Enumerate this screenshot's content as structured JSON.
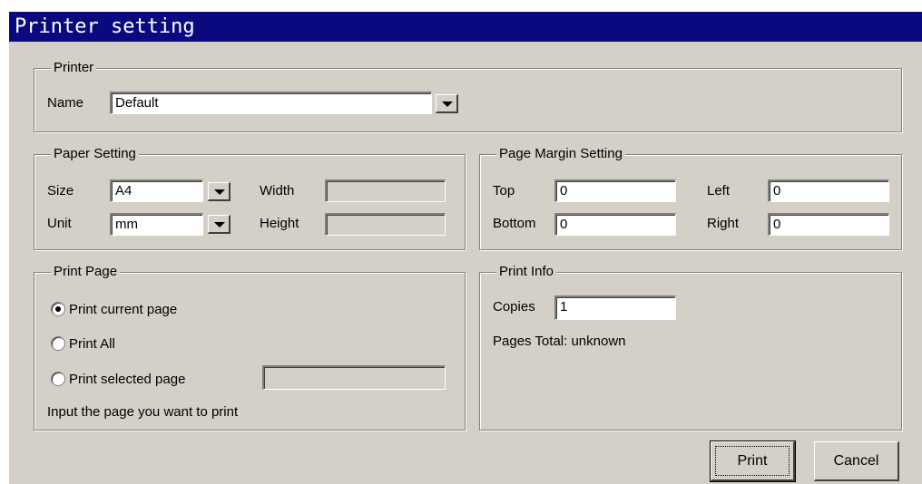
{
  "window": {
    "title": "Printer setting"
  },
  "printer": {
    "legend": "Printer",
    "name_label": "Name",
    "name_value": "Default"
  },
  "paper": {
    "legend": "Paper Setting",
    "size_label": "Size",
    "size_value": "A4",
    "width_label": "Width",
    "width_value": "",
    "unit_label": "Unit",
    "unit_value": "mm",
    "height_label": "Height",
    "height_value": ""
  },
  "margin": {
    "legend": "Page Margin Setting",
    "top_label": "Top",
    "top_value": "0",
    "left_label": "Left",
    "left_value": "0",
    "bottom_label": "Bottom",
    "bottom_value": "0",
    "right_label": "Right",
    "right_value": "0"
  },
  "print_page": {
    "legend": "Print Page",
    "options": [
      {
        "label": "Print current page",
        "checked": true
      },
      {
        "label": "Print All",
        "checked": false
      },
      {
        "label": "Print selected page",
        "checked": false
      }
    ],
    "selected_pages_value": "",
    "hint": "Input the page you want to print"
  },
  "print_info": {
    "legend": "Print Info",
    "copies_label": "Copies",
    "copies_value": "1",
    "pages_total": "Pages Total: unknown"
  },
  "buttons": {
    "print": "Print",
    "cancel": "Cancel"
  },
  "colors": {
    "titlebar": "#0a0a80",
    "face": "#d4d0c8",
    "shadow": "#808080",
    "highlight": "#ffffff"
  },
  "icons": {
    "dropdown": "chevron-down-icon",
    "radio": "radio-icon"
  }
}
